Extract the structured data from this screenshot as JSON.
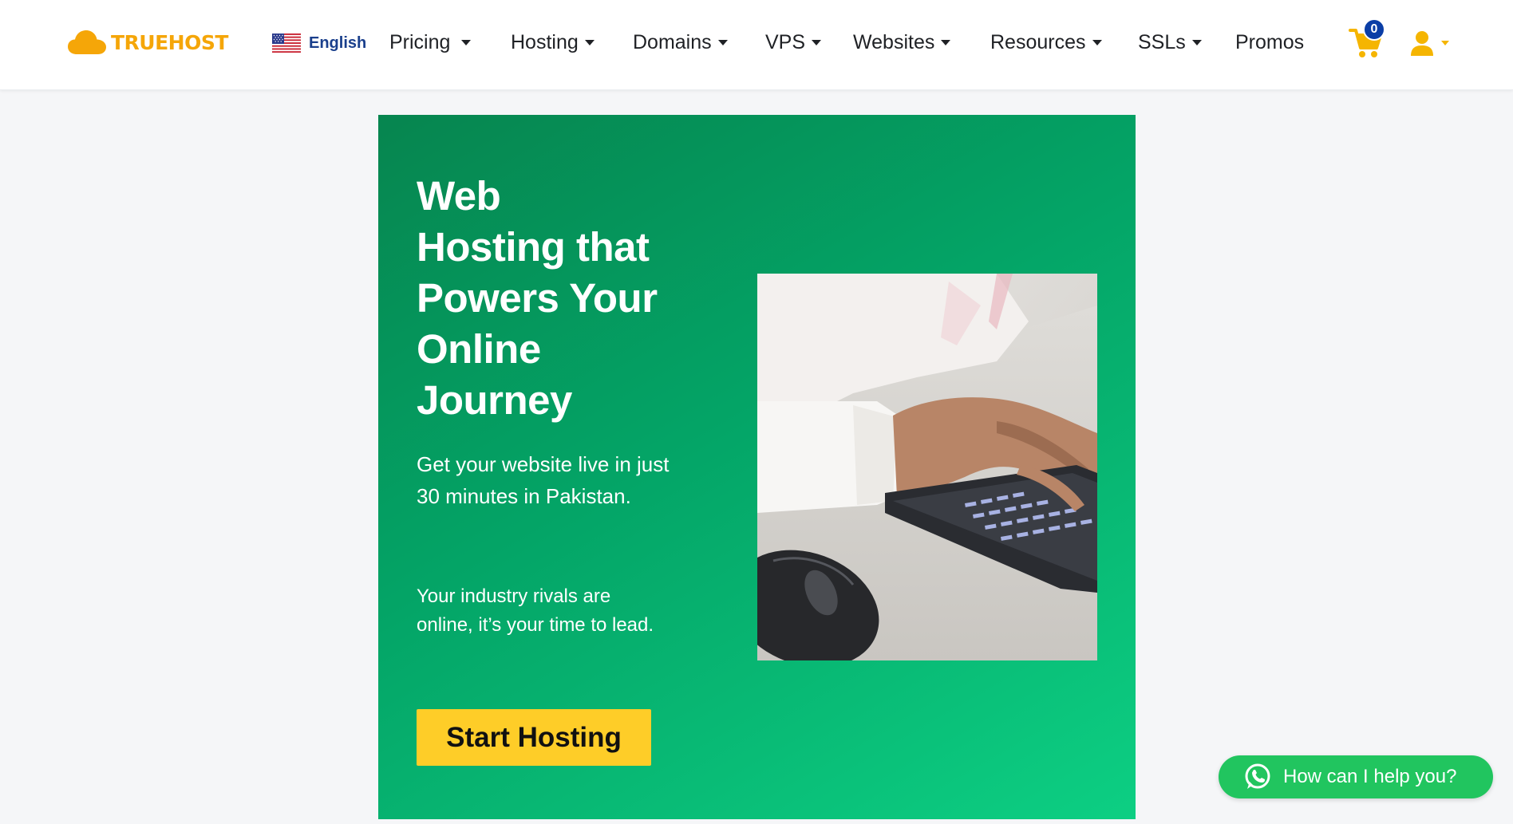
{
  "brand": {
    "name": "TRUEHOST",
    "color": "#f5a608"
  },
  "language": {
    "label": "English",
    "flag": "us-flag-icon"
  },
  "nav": {
    "items": [
      {
        "label": "Pricing",
        "has_dropdown": true
      },
      {
        "label": "Hosting",
        "has_dropdown": true
      },
      {
        "label": "Domains",
        "has_dropdown": true
      },
      {
        "label": "VPS",
        "has_dropdown": true
      },
      {
        "label": "Websites",
        "has_dropdown": true
      },
      {
        "label": "Resources",
        "has_dropdown": true
      },
      {
        "label": "SSLs",
        "has_dropdown": true
      },
      {
        "label": "Promos",
        "has_dropdown": false
      }
    ]
  },
  "cart": {
    "count": "0",
    "icon": "cart-icon",
    "color": "#f5b501",
    "badge_color": "#0b3ea6"
  },
  "user": {
    "icon": "user-icon"
  },
  "hero": {
    "title_lines": [
      "Web",
      "Hosting that",
      "Powers Your",
      "Online",
      "Journey"
    ],
    "subtitle": "Get your website live in just 30 minutes in Pakistan.",
    "tagline": "Your industry rivals are online, it’s your time to lead.",
    "cta_label": "Start Hosting",
    "cta_color": "#fecd28",
    "background_from": "#06854f",
    "background_to": "#0dcf83"
  },
  "chat": {
    "label": "How can I help you?",
    "icon": "whatsapp-icon",
    "color": "#21c55f"
  }
}
